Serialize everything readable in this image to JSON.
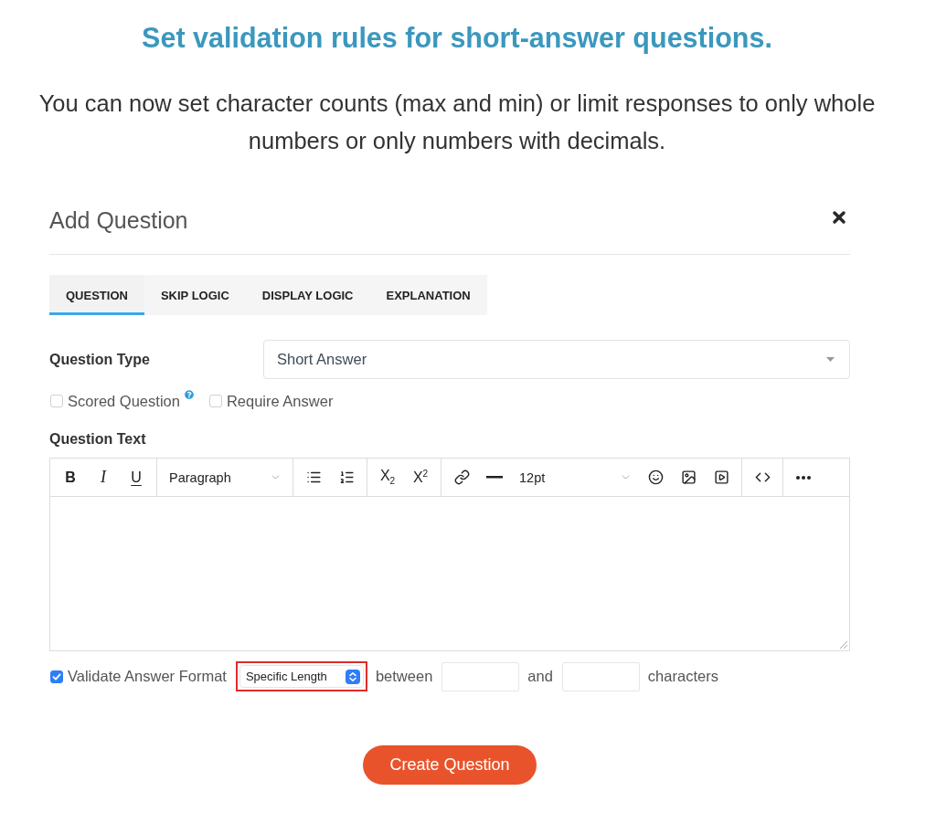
{
  "heading": "Set validation rules for short-answer questions.",
  "intro": "You can now set character counts (max and min) or limit responses to only whole numbers or only numbers with decimals.",
  "dialog": {
    "title": "Add Question",
    "tabs": [
      {
        "label": "QUESTION",
        "selected": true
      },
      {
        "label": "SKIP LOGIC",
        "selected": false
      },
      {
        "label": "DISPLAY LOGIC",
        "selected": false
      },
      {
        "label": "EXPLANATION",
        "selected": false
      }
    ],
    "question_type": {
      "label": "Question Type",
      "value": "Short Answer"
    },
    "options": [
      {
        "label": "Scored Question",
        "checked": false,
        "help": true
      },
      {
        "label": "Require Answer",
        "checked": false,
        "help": false
      }
    ],
    "question_text": {
      "label": "Question Text",
      "toolbar": [
        {
          "items": [
            {
              "kind": "bold",
              "label": "B"
            },
            {
              "kind": "italic",
              "label": "I"
            },
            {
              "kind": "underline",
              "label": "U"
            }
          ]
        },
        {
          "items": [
            {
              "kind": "dropdown",
              "label": "Paragraph"
            }
          ]
        },
        {
          "items": [
            {
              "kind": "bullet-list"
            },
            {
              "kind": "numbered-list"
            }
          ]
        },
        {
          "items": [
            {
              "kind": "subscript",
              "label": "X$_{2}$"
            },
            {
              "kind": "superscript",
              "label": "X$^{2}$"
            }
          ]
        },
        {
          "items": [
            {
              "kind": "link"
            },
            {
              "kind": "rule"
            },
            {
              "kind": "dropdown",
              "label": "12pt"
            },
            {
              "kind": "emoji"
            },
            {
              "kind": "image"
            },
            {
              "kind": "media"
            }
          ]
        },
        {
          "items": [
            {
              "kind": "code"
            }
          ]
        },
        {
          "items": [
            {
              "kind": "more"
            }
          ]
        }
      ]
    },
    "validation": {
      "label": "Validate Answer Format",
      "checked": true,
      "format": {
        "value": "Specific Length",
        "highlighted": true
      },
      "parts": [
        {
          "kind": "text",
          "text": "between"
        },
        {
          "kind": "input"
        },
        {
          "kind": "text",
          "text": "and"
        },
        {
          "kind": "input"
        },
        {
          "kind": "text",
          "text": "characters"
        }
      ]
    },
    "submit": "Create Question"
  }
}
